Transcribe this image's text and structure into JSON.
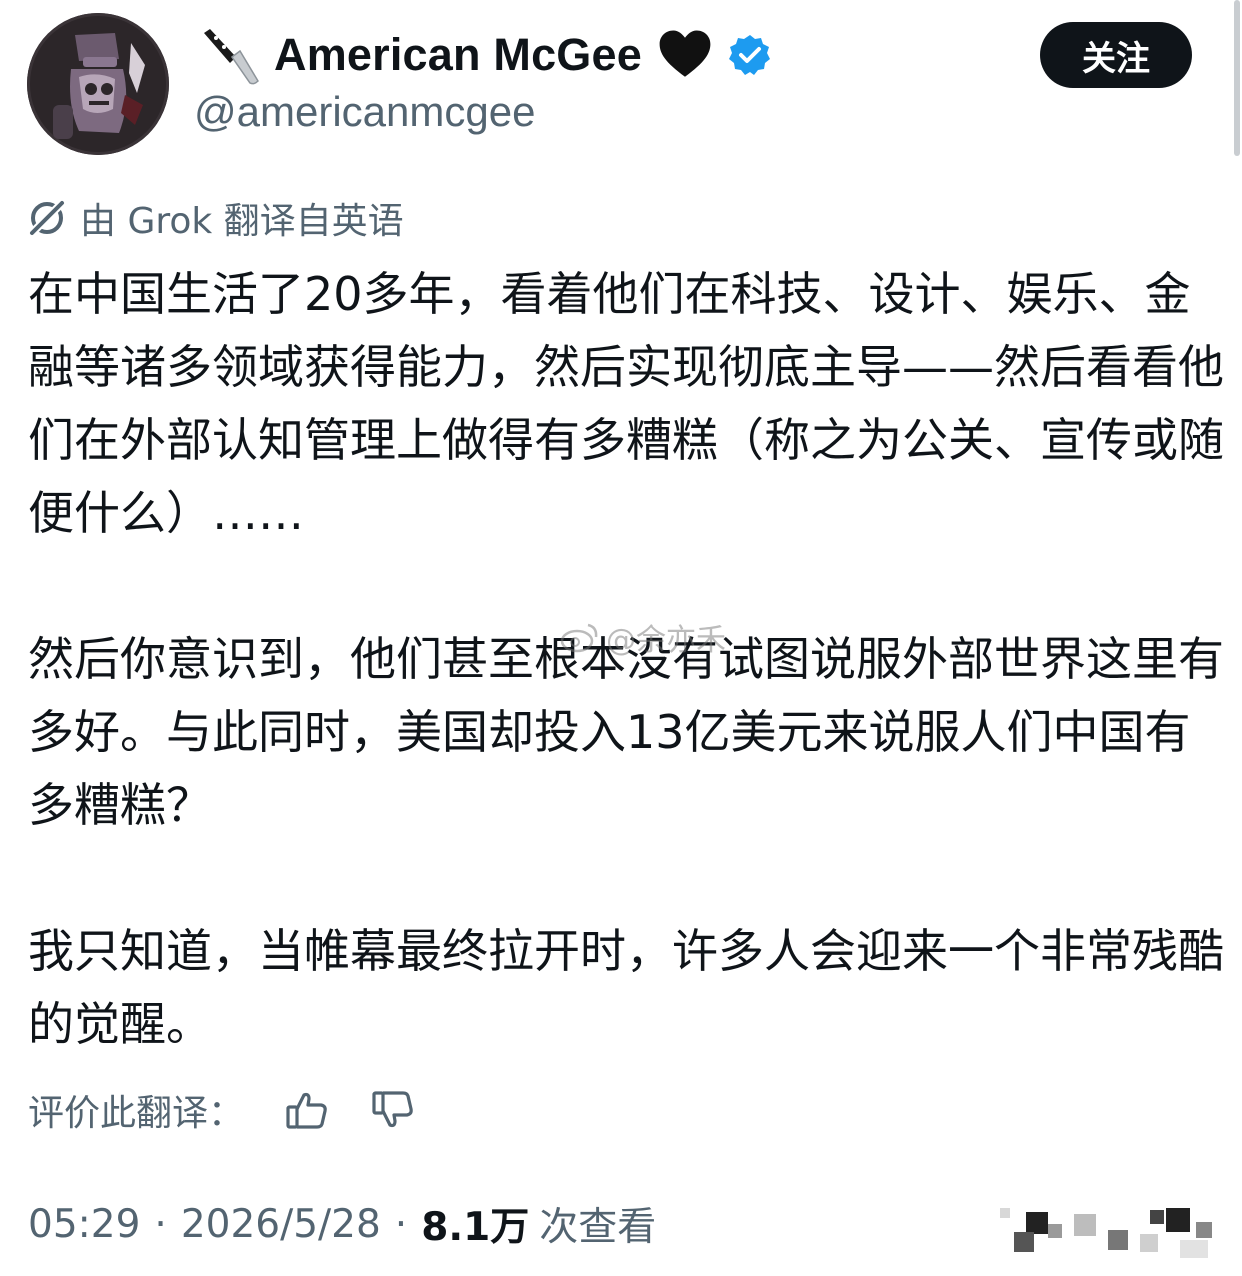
{
  "user": {
    "display_name": "American McGee",
    "handle": "@americanmcgee",
    "name_emoji_prefix": "kitchen-knife-icon",
    "name_emoji_suffix": "black-heart-icon",
    "verified": true,
    "verified_color": "#1d9bf0"
  },
  "follow_button": {
    "label": "关注"
  },
  "translation": {
    "note": "由 Grok 翻译自英语",
    "icon": "grok-icon"
  },
  "tweet": {
    "paragraphs": [
      "在中国生活了20多年，看着他们在科技、设计、娱乐、金融等诸多领域获得能力，然后实现彻底主导——然后看看他们在外部认知管理上做得有多糟糕（称之为公关、宣传或随便什么）……",
      "然后你意识到，他们甚至根本没有试图说服外部世界这里有多好。与此同时，美国却投入13亿美元来说服人们中国有多糟糕？",
      "我只知道，当帷幕最终拉开时，许多人会迎来一个非常残酷的觉醒。"
    ]
  },
  "rate": {
    "label": "评价此翻译：",
    "thumbs_up": "thumbs-up-icon",
    "thumbs_down": "thumbs-down-icon"
  },
  "meta": {
    "time": "05:29",
    "separator": "·",
    "date": "2026/5/28",
    "views_count": "8.1万",
    "views_label": "次查看"
  },
  "watermark": {
    "text": "@余亦禾"
  },
  "colors": {
    "text": "#0f1419",
    "secondary": "#536471",
    "button_bg": "#0f1419",
    "background": "#ffffff"
  }
}
